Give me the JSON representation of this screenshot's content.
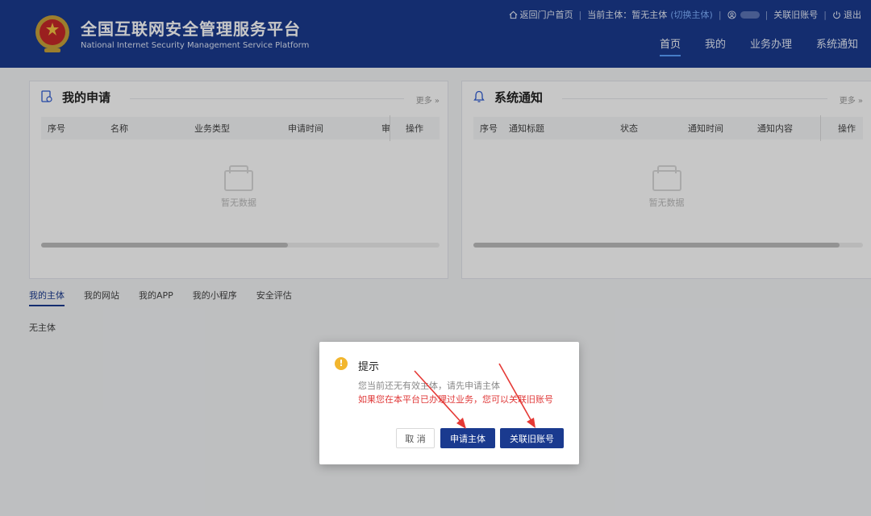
{
  "header": {
    "title": "全国互联网安全管理服务平台",
    "subtitle": "National Internet Security Management Service Platform",
    "topbar": {
      "back_home": "返回门户首页",
      "current_entity_label": "当前主体：暂无主体",
      "switch_entity": "(切换主体)",
      "link_old_account": "关联旧账号",
      "logout": "退出"
    },
    "nav": [
      "首页",
      "我的",
      "业务办理",
      "系统通知"
    ]
  },
  "my_applications": {
    "title": "我的申请",
    "more": "更多 »",
    "columns": [
      "序号",
      "名称",
      "业务类型",
      "申请时间",
      "审",
      "操作"
    ],
    "empty_text": "暂无数据"
  },
  "system_notices": {
    "title": "系统通知",
    "more": "更多 »",
    "columns": [
      "序号",
      "通知标题",
      "状态",
      "通知时间",
      "通知内容",
      "操作"
    ],
    "empty_text": "暂无数据"
  },
  "tabs": [
    "我的主体",
    "我的网站",
    "我的APP",
    "我的小程序",
    "安全评估"
  ],
  "no_entity_text": "无主体",
  "dialog": {
    "title": "提示",
    "message1": "您当前还无有效主体，请先申请主体",
    "message2": "如果您在本平台已办理过业务，您可以关联旧账号",
    "cancel": "取 消",
    "apply": "申请主体",
    "link_account": "关联旧账号"
  },
  "colors": {
    "header_bg": "#1a3a8f",
    "primary_button": "#1a3a8f",
    "warning_text": "#e03a3a",
    "warning_icon": "#f2b62e",
    "annotation_arrow": "#e53935"
  }
}
